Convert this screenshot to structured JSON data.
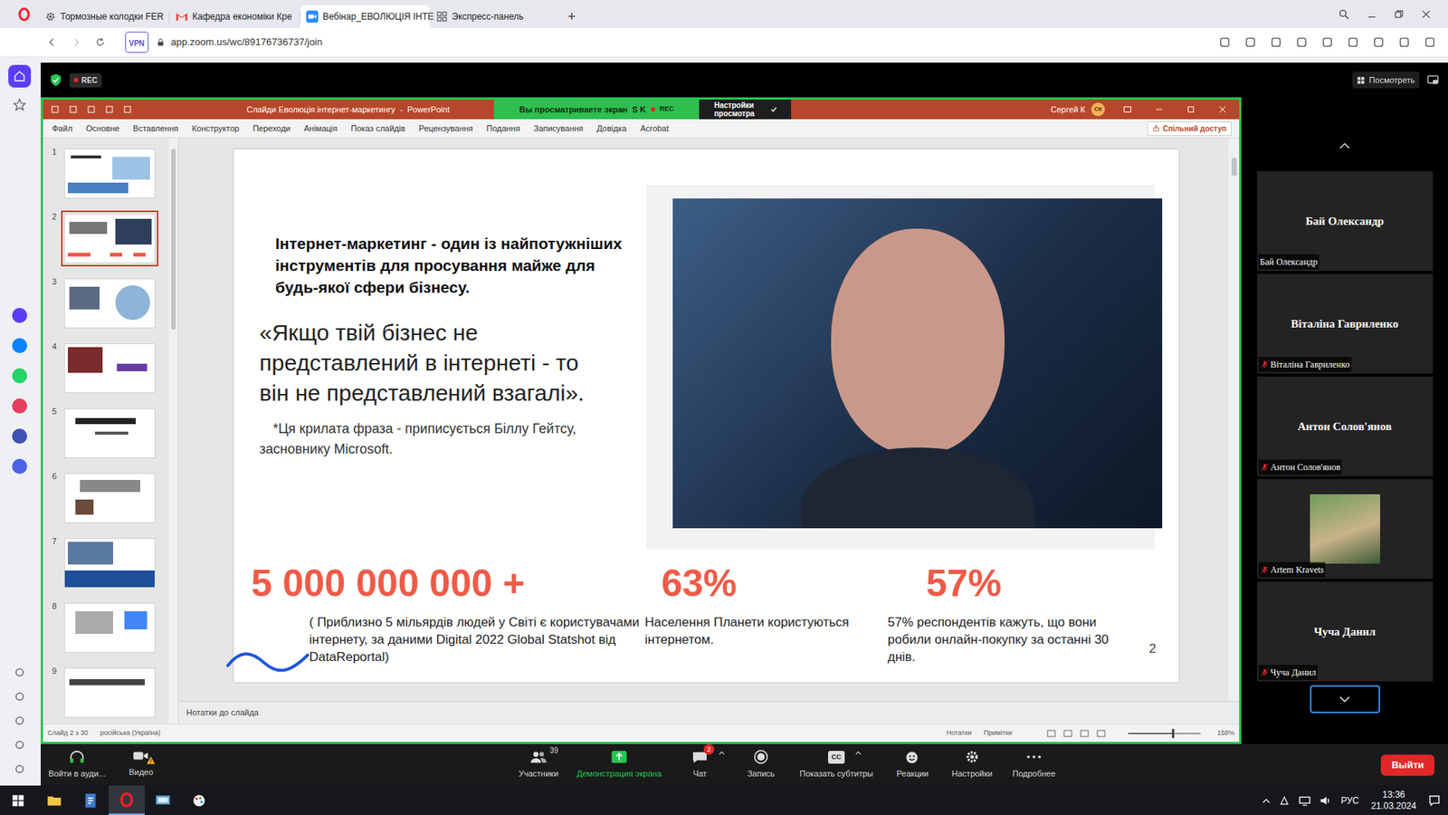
{
  "browser": {
    "tabs": [
      {
        "label": "Тормозные колодки FER",
        "selected": false
      },
      {
        "label": "Кафедра економіки Кре",
        "selected": false
      },
      {
        "label": "Вебінар_ЕВОЛЮЦІЯ ІНТЕ",
        "selected": true
      },
      {
        "label": "Экспресс-панель",
        "selected": false
      }
    ],
    "new_tab": "+",
    "address": {
      "vpn": "VPN",
      "url": "app.zoom.us/wc/89176736737/join"
    }
  },
  "zoom": {
    "rec": "REC",
    "view_button": "Посмотреть",
    "banner": {
      "text": "Вы просматриваете экран",
      "initials": "S K",
      "rec": "REC",
      "settings": "Настройки просмотра"
    }
  },
  "powerpoint": {
    "title": "Слайди Еволюція інтернет-маркетингу  -  PowerPoint",
    "user": "Сергей К",
    "user_initials": "СК",
    "menu": [
      "Файл",
      "Основне",
      "Вставлення",
      "Конструктор",
      "Переходи",
      "Анімація",
      "Показ слайдів",
      "Рецензування",
      "Подання",
      "Записування",
      "Довідка",
      "Acrobat"
    ],
    "share": "Спільний доступ",
    "thumbnails": [
      {
        "number": "1",
        "selected": false
      },
      {
        "number": "2",
        "selected": true
      },
      {
        "number": "3",
        "selected": false
      },
      {
        "number": "4",
        "selected": false
      },
      {
        "number": "5",
        "selected": false
      },
      {
        "number": "6",
        "selected": false
      },
      {
        "number": "7",
        "selected": false
      },
      {
        "number": "8",
        "selected": false
      },
      {
        "number": "9",
        "selected": false
      }
    ],
    "slide": {
      "heading": "Інтернет-маркетинг - один із найпотужніших інструментів для просування майже для будь-якої сфери бізнесу.",
      "quote": "«Якщо твій бізнес не представлений в інтернеті - то він не представлений взагалі».",
      "footnote": "*Ця крилата фраза - приписується Біллу Гейтсу, засновнику Microsoft.",
      "stats": [
        {
          "value": "5 000 000 000 +",
          "caption": "( Приблизно 5 мільярдів людей у Світі є користувачами інтернету, за даними Digital 2022 Global Statshot від DataReportal)"
        },
        {
          "value": "63%",
          "caption": "Населення Планети користуються інтернетом."
        },
        {
          "value": "57%",
          "caption": "57% респондентів кажуть, що вони робили онлайн-покупку за останні 30 днів."
        }
      ],
      "page_number": "2"
    },
    "notes": "Нотатки до слайда",
    "status_bar": {
      "slide": "Слайд 2 з 30",
      "language": "російська (Україна)",
      "notes": "Нотатки",
      "comments": "Примітки",
      "zoom": "158%",
      "zoom_level": 0.6
    }
  },
  "participants": [
    {
      "kind": "name",
      "display_name": "Бай Олександр",
      "label": "Бай Олександр",
      "muted": false
    },
    {
      "kind": "name",
      "display_name": "Віталіна Гавриленко",
      "label": "Віталіна Гавриленко",
      "muted": true
    },
    {
      "kind": "name",
      "display_name": "Антон Солов'янов",
      "label": "Антон Солов'янов",
      "muted": true
    },
    {
      "kind": "video",
      "label": "Artem Kravets",
      "muted": true
    },
    {
      "kind": "name",
      "display_name": "Чуча Данил",
      "label": "Чуча Данил",
      "muted": true
    }
  ],
  "toolbar": {
    "left": [
      {
        "label": "Войти в ауди...",
        "warning": false
      },
      {
        "label": "Видео",
        "warning": true
      }
    ],
    "center": [
      {
        "label": "Участники",
        "count": "39",
        "active": false
      },
      {
        "label": "Демонстрация экрана",
        "active": true
      },
      {
        "label": "Чат",
        "badge": "2",
        "active": false
      },
      {
        "label": "Запись",
        "active": false
      },
      {
        "label": "Показать субтитры",
        "glyph": "CC",
        "active": false
      },
      {
        "label": "Реакции",
        "active": false
      },
      {
        "label": "Настройки",
        "active": false
      },
      {
        "label": "Подробнее",
        "active": false
      }
    ],
    "leave": "Выйти"
  },
  "taskbar": {
    "language": "РУС",
    "time": "13:36",
    "date": "21.03.2024"
  }
}
